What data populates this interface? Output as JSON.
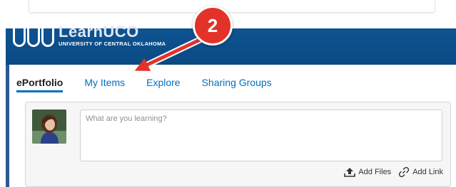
{
  "annotation": {
    "step": "2"
  },
  "branding": {
    "logo_title": "LearnUCO",
    "logo_subtitle": "UNIVERSITY OF CENTRAL OKLAHOMA"
  },
  "tabs": [
    {
      "label": "ePortfolio",
      "active": true
    },
    {
      "label": "My Items",
      "active": false
    },
    {
      "label": "Explore",
      "active": false
    },
    {
      "label": "Sharing Groups",
      "active": false
    }
  ],
  "composer": {
    "placeholder": "What are you learning?",
    "add_files_label": "Add Files",
    "add_link_label": "Add Link"
  },
  "colors": {
    "header": "#0b4f8a",
    "tab_link": "#006fbf",
    "callout": "#e3322a"
  }
}
